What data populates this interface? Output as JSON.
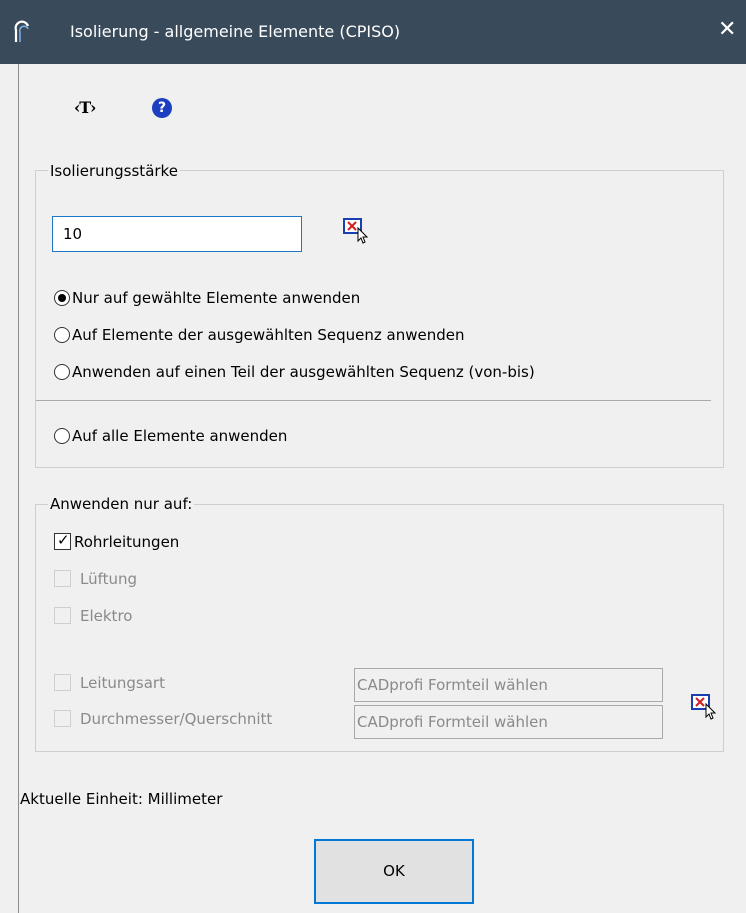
{
  "window": {
    "title": "Isolierung - allgemeine Elemente (CPISO)",
    "close_glyph": "✕",
    "title_bar_color": "#394a5b"
  },
  "toolbar": {
    "text_button": "‹T›",
    "help_icon": "help-icon",
    "help_glyph": "?"
  },
  "insulation": {
    "legend": "Isolierungsstärke",
    "thickness_value": "10",
    "pick_icon": "pick-from-drawing-icon",
    "options": [
      {
        "label": "Nur auf gewählte Elemente anwenden",
        "checked": true
      },
      {
        "label": "Auf Elemente der ausgewählten Sequenz anwenden",
        "checked": false
      },
      {
        "label": "Anwenden auf einen Teil der ausgewählten Sequenz (von-bis)",
        "checked": false
      },
      {
        "label": "Auf alle Elemente anwenden",
        "checked": false
      }
    ]
  },
  "apply_only": {
    "legend": "Anwenden nur auf:",
    "items": [
      {
        "label": "Rohrleitungen",
        "checked": true,
        "enabled": true
      },
      {
        "label": "Lüftung",
        "checked": false,
        "enabled": false
      },
      {
        "label": "Elektro",
        "checked": false,
        "enabled": false
      }
    ],
    "filters": [
      {
        "label": "Leitungsart",
        "value": "CADprofi Formteil wählen",
        "enabled": false
      },
      {
        "label": "Durchmesser/Querschnitt",
        "value": "CADprofi Formteil wählen",
        "enabled": false
      }
    ]
  },
  "footer": {
    "unit_text": "Aktuelle Einheit: Millimeter",
    "ok_label": "OK"
  }
}
